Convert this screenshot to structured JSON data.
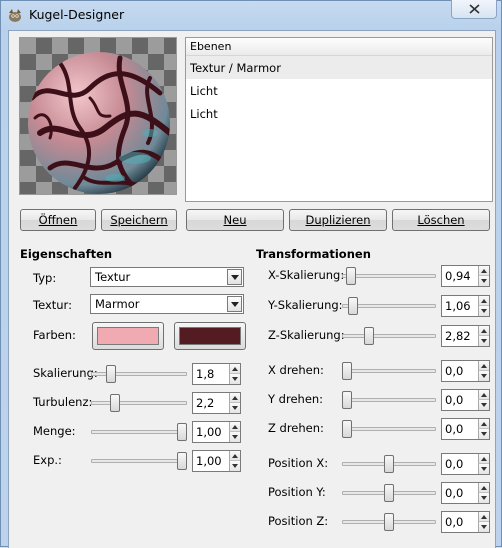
{
  "window": {
    "title": "Kugel-Designer",
    "close_icon": "close-icon"
  },
  "layers": {
    "header": "Ebenen",
    "items": [
      {
        "label": "Textur / Marmor",
        "selected": true
      },
      {
        "label": "Licht",
        "selected": false
      },
      {
        "label": "Licht",
        "selected": false
      }
    ]
  },
  "buttons": {
    "open": "Öffnen",
    "save": "Speichern",
    "new": "Neu",
    "duplicate": "Duplizieren",
    "delete": "Löschen"
  },
  "properties": {
    "title": "Eigenschaften",
    "type_label": "Typ:",
    "type_value": "Textur",
    "texture_label": "Textur:",
    "texture_value": "Marmor",
    "colors_label": "Farben:",
    "color1": "#f0aab2",
    "color2": "#521c22",
    "sliders": [
      {
        "label": "Skalierung:",
        "value": "1,8",
        "level": 0.18
      },
      {
        "label": "Turbulenz:",
        "value": "2,2",
        "level": 0.22
      },
      {
        "label": "Menge:",
        "value": "1,00",
        "level": 1.0
      },
      {
        "label": "Exp.:",
        "value": "1,00",
        "level": 1.0
      }
    ]
  },
  "transformations": {
    "title": "Transformationen",
    "rows": [
      {
        "label": "X-Skalierung:",
        "value": "0,94",
        "level": 0.05
      },
      {
        "label": "Y-Skalierung:",
        "value": "1,06",
        "level": 0.07
      },
      {
        "label": "Z-Skalierung:",
        "value": "2,82",
        "level": 0.26
      },
      {
        "label": "X drehen:",
        "value": "0,0",
        "level": 0.0
      },
      {
        "label": "Y drehen:",
        "value": "0,0",
        "level": 0.0
      },
      {
        "label": "Z drehen:",
        "value": "0,0",
        "level": 0.0
      },
      {
        "label": "Position X:",
        "value": "0,0",
        "level": 0.5
      },
      {
        "label": "Position Y:",
        "value": "0,0",
        "level": 0.5
      },
      {
        "label": "Position Z:",
        "value": "0,0",
        "level": 0.5
      }
    ]
  }
}
